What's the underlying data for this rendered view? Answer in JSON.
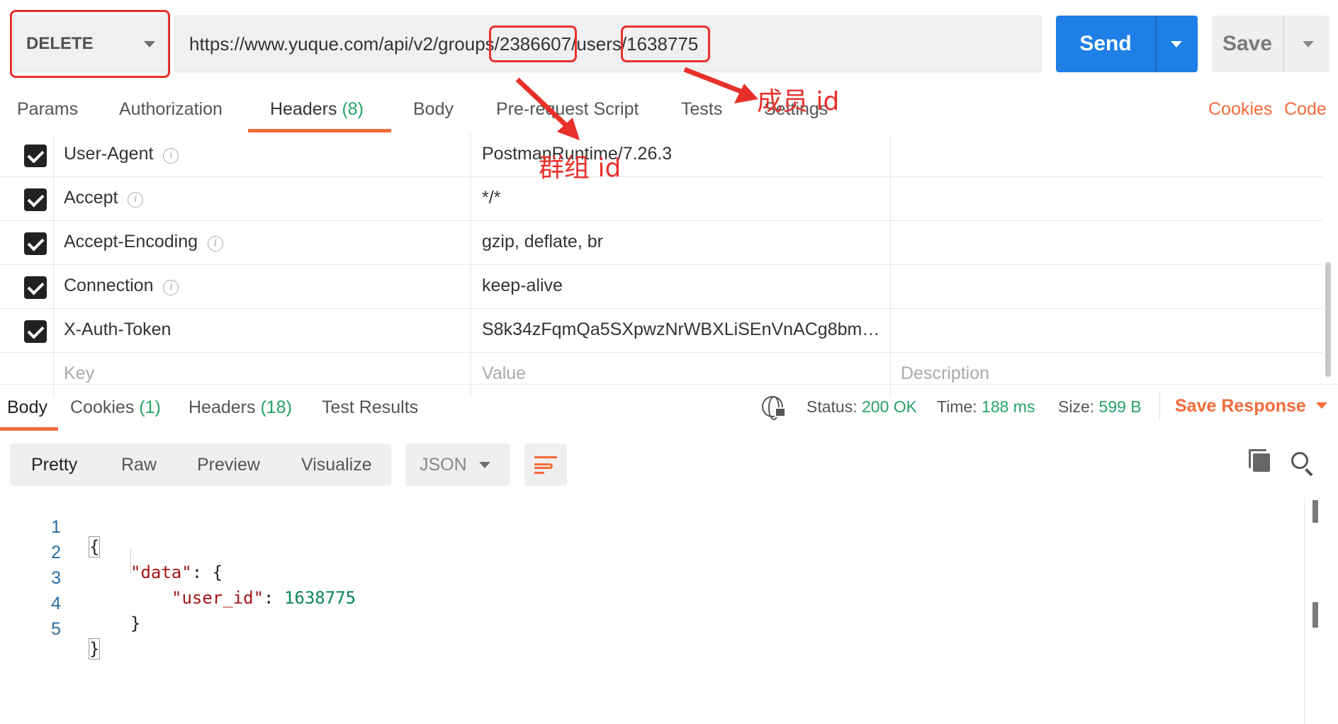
{
  "request": {
    "method": "DELETE",
    "url": "https://www.yuque.com/api/v2/groups/2386607/users/1638775",
    "send_label": "Send",
    "save_label": "Save"
  },
  "request_tabs": [
    {
      "label": "Params",
      "count": ""
    },
    {
      "label": "Authorization",
      "count": ""
    },
    {
      "label": "Headers",
      "count": "(8)"
    },
    {
      "label": "Body",
      "count": ""
    },
    {
      "label": "Pre-request Script",
      "count": ""
    },
    {
      "label": "Tests",
      "count": ""
    },
    {
      "label": "Settings",
      "count": ""
    }
  ],
  "request_links": {
    "cookies": "Cookies",
    "code": "Code"
  },
  "headers": [
    {
      "key": "User-Agent",
      "value": "PostmanRuntime/7.26.3"
    },
    {
      "key": "Accept",
      "value": "*/*"
    },
    {
      "key": "Accept-Encoding",
      "value": "gzip, deflate, br"
    },
    {
      "key": "Connection",
      "value": "keep-alive"
    },
    {
      "key": "X-Auth-Token",
      "value": "S8k34zFqmQa5SXpwzNrWBXLiSEnVnACg8bmZW..."
    }
  ],
  "header_placeholders": {
    "key": "Key",
    "value": "Value",
    "description": "Description"
  },
  "info_glyph": "i",
  "response_tabs": [
    {
      "label": "Body",
      "count": ""
    },
    {
      "label": "Cookies",
      "count": "(1)"
    },
    {
      "label": "Headers",
      "count": "(18)"
    },
    {
      "label": "Test Results",
      "count": ""
    }
  ],
  "status": {
    "status_label": "Status:",
    "status_value": "200 OK",
    "time_label": "Time:",
    "time_value": "188 ms",
    "size_label": "Size:",
    "size_value": "599 B"
  },
  "save_response_label": "Save Response",
  "view_options": [
    "Pretty",
    "Raw",
    "Preview",
    "Visualize"
  ],
  "format": "JSON",
  "code_lines": [
    {
      "n": "1"
    },
    {
      "n": "2"
    },
    {
      "n": "3"
    },
    {
      "n": "4"
    },
    {
      "n": "5"
    }
  ],
  "code_tokens": {
    "open": "{",
    "data_key": "\"data\"",
    "colon_open": ": {",
    "user_key": "\"user_id\"",
    "colon": ": ",
    "user_val": "1638775",
    "close_inner": "}",
    "close": "}"
  },
  "annotations": {
    "member_id": "成员 id",
    "group_id": "群组 id",
    "color": "#e8302a"
  },
  "colors": {
    "accent": "#f26b3a",
    "send": "#1e7fe6",
    "success": "#26a269"
  },
  "icons": [
    "info-icon",
    "globe-lock-icon",
    "copy-icon",
    "search-icon",
    "wrap-lines-icon",
    "chevron-down-icon"
  ]
}
